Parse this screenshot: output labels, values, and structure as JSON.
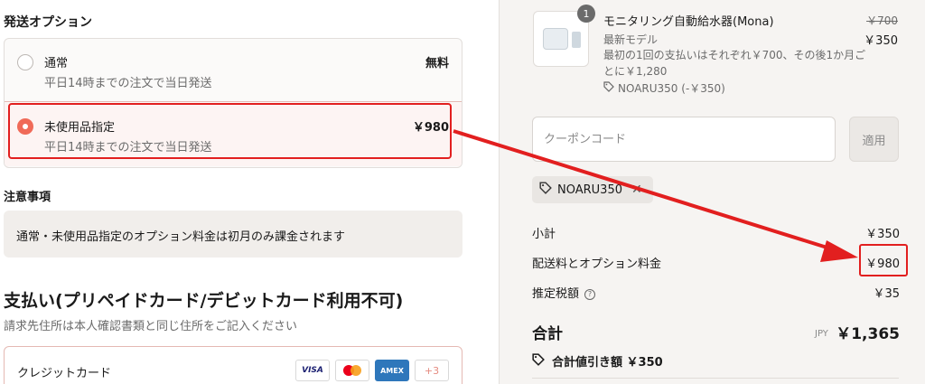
{
  "shipping": {
    "heading": "発送オプション",
    "options": [
      {
        "title": "通常",
        "subtitle": "平日14時までの注文で当日発送",
        "price": "無料",
        "selected": false
      },
      {
        "title": "未使用品指定",
        "subtitle": "平日14時までの注文で当日発送",
        "price": "￥980",
        "selected": true
      }
    ]
  },
  "notes": {
    "heading": "注意事項",
    "text": "通常・未使用品指定のオプション料金は初月のみ課金されます"
  },
  "payment": {
    "heading": "支払い(プリペイドカード/デビットカード利用不可)",
    "subtitle": "請求先住所は本人確認書類と同じ住所をご記入ください",
    "method_label": "クレジットカード",
    "cards": [
      "VISA",
      "mastercard",
      "AMEX"
    ],
    "more_cards": "+3"
  },
  "product": {
    "quantity": "1",
    "name": "モニタリング自動給水器(Mona)",
    "variant": "最新モデル",
    "description": "最初の1回の支払いはそれぞれ￥700、その後1か月ごとに￥1,280",
    "discount_label": "NOARU350 (-￥350)",
    "original_price": "￥700",
    "price": "￥350"
  },
  "coupon": {
    "placeholder": "クーポンコード",
    "apply_label": "適用",
    "applied_code": "NOARU350"
  },
  "summary": {
    "subtotal_label": "小計",
    "subtotal": "￥350",
    "shipping_label": "配送料とオプション料金",
    "shipping": "￥980",
    "tax_label": "推定税額",
    "tax": "￥35",
    "total_label": "合計",
    "currency": "JPY",
    "total": "￥1,365",
    "savings_label": "合計値引き額 ￥350"
  },
  "colors": {
    "accent": "#f06a58",
    "highlight": "#e21f1f"
  }
}
